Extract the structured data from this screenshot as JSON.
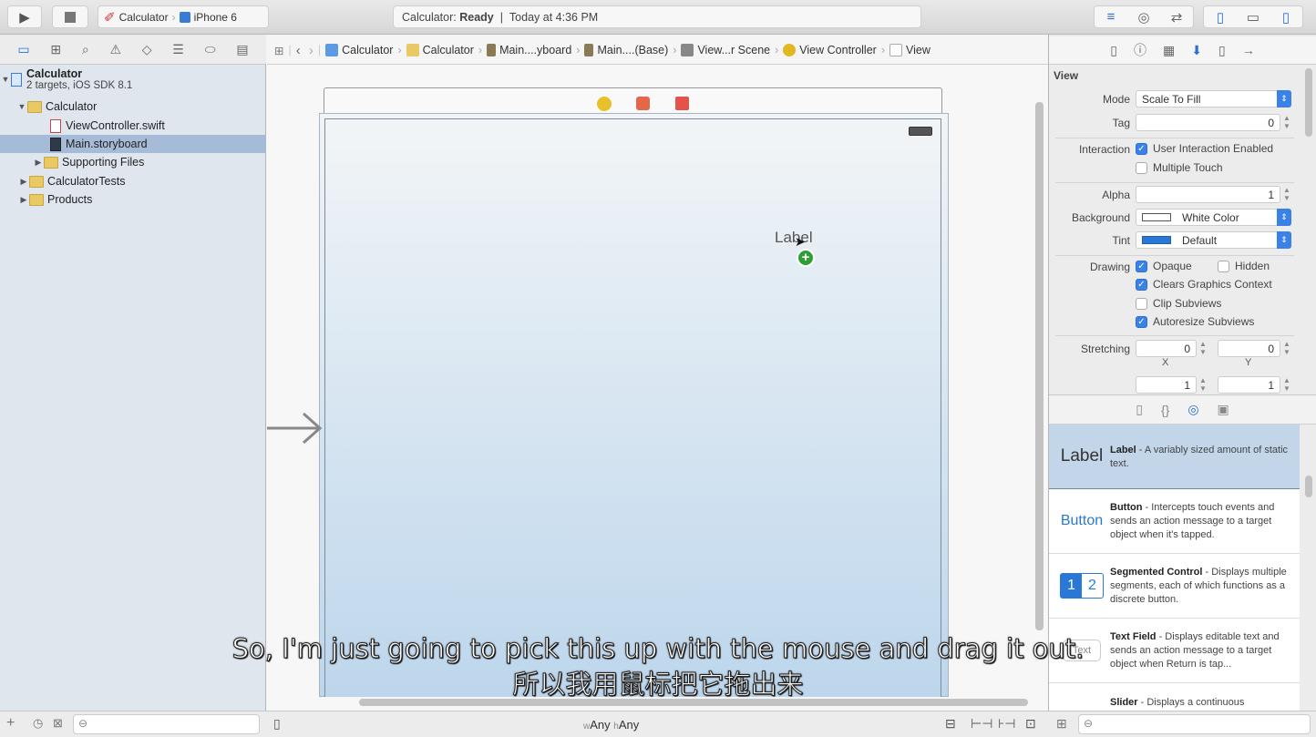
{
  "toolbar": {
    "scheme": "Calculator",
    "device": "iPhone 6",
    "status_app": "Calculator:",
    "status_state": "Ready",
    "status_sep": "|",
    "status_time": "Today at 4:36 PM"
  },
  "navigator": {
    "project": {
      "name": "Calculator",
      "subtitle": "2 targets, iOS SDK 8.1"
    },
    "items": [
      {
        "label": "Calculator",
        "type": "folder",
        "expanded": true
      },
      {
        "label": "ViewController.swift",
        "type": "swift"
      },
      {
        "label": "Main.storyboard",
        "type": "storyboard",
        "selected": true
      },
      {
        "label": "Supporting Files",
        "type": "folder"
      },
      {
        "label": "CalculatorTests",
        "type": "folder"
      },
      {
        "label": "Products",
        "type": "folder"
      }
    ]
  },
  "breadcrumb": [
    "Calculator",
    "Calculator",
    "Main....yboard",
    "Main....(Base)",
    "View...r Scene",
    "View Controller",
    "View"
  ],
  "canvas": {
    "dragged_label": "Label",
    "size_class_w_prefix": "w",
    "size_class_w": "Any",
    "size_class_h_prefix": "h",
    "size_class_h": "Any"
  },
  "inspector": {
    "section": "View",
    "mode_label": "Mode",
    "mode": "Scale To Fill",
    "tag_label": "Tag",
    "tag": "0",
    "interaction_label": "Interaction",
    "user_interaction": "User Interaction Enabled",
    "multiple_touch": "Multiple Touch",
    "alpha_label": "Alpha",
    "alpha": "1",
    "background_label": "Background",
    "background": "White Color",
    "tint_label": "Tint",
    "tint": "Default",
    "drawing_label": "Drawing",
    "opaque": "Opaque",
    "hidden": "Hidden",
    "clears": "Clears Graphics Context",
    "clip": "Clip Subviews",
    "autoresize": "Autoresize Subviews",
    "stretching_label": "Stretching",
    "stretch_x": "0",
    "stretch_y": "0",
    "x_label": "X",
    "y_label": "Y",
    "stretch_w": "1",
    "stretch_h": "1",
    "checks": {
      "user_interaction": true,
      "multiple_touch": false,
      "opaque": true,
      "hidden": false,
      "clears": true,
      "clip": false,
      "autoresize": true
    }
  },
  "library": [
    {
      "icon": "Label",
      "name": "Label",
      "desc": " - A variably sized amount of static text."
    },
    {
      "icon": "Button",
      "name": "Button",
      "desc": " - Intercepts touch events and sends an action message to a target object when it's tapped."
    },
    {
      "icon_1": "1",
      "icon_2": "2",
      "name": "Segmented Control",
      "desc": " - Displays multiple segments, each of which functions as a discrete button."
    },
    {
      "icon": "Text",
      "name": "Text Field",
      "desc": " - Displays editable text and sends an action message to a target object when Return is tap..."
    },
    {
      "name": "Slider",
      "desc": " - Displays a continuous"
    }
  ],
  "subtitles": {
    "en": "So, I'm just going to pick this up with the mouse and drag it out.",
    "zh": "所以我用鼠标把它拖出来"
  },
  "colors": {
    "accent": "#3b82e6",
    "selection": "#a6bbd7",
    "folder": "#e8c964"
  }
}
